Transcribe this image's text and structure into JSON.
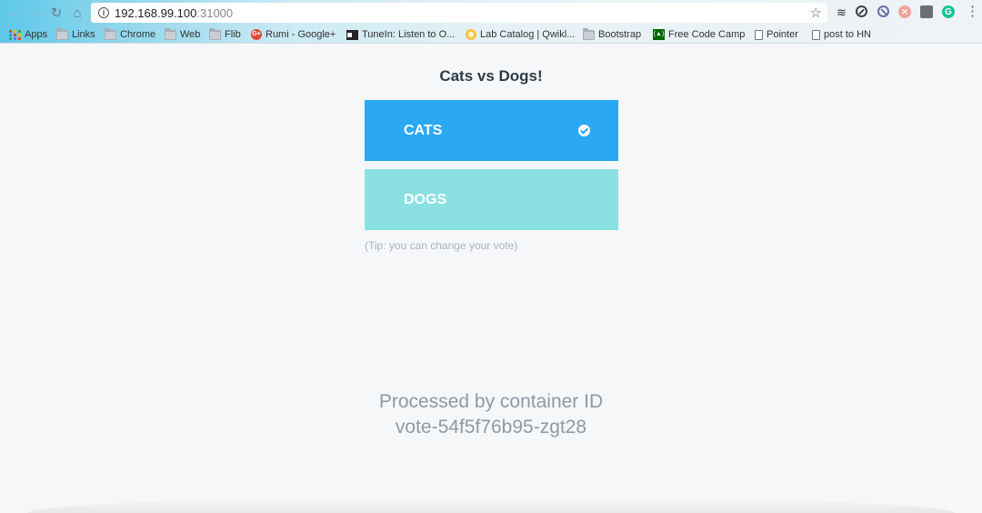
{
  "browser": {
    "url_host": "192.168.99.100",
    "url_port": ":31000",
    "nav": {
      "back_icon": "←",
      "forward_icon": "→",
      "reload_icon": "↻",
      "home_icon": "⌂",
      "star_icon": "☆",
      "menu_icon": "⋮"
    },
    "extensions": [
      {
        "name": "buffer-extension-icon",
        "glyph": "≋"
      },
      {
        "name": "compass-extension-icon",
        "glyph": ""
      },
      {
        "name": "block-extension-icon",
        "glyph": ""
      },
      {
        "name": "red-extension-icon",
        "glyph": "✕"
      },
      {
        "name": "bulb-extension-icon",
        "glyph": "💡"
      },
      {
        "name": "grammarly-extension-icon",
        "glyph": "G"
      }
    ],
    "bookmarks": [
      {
        "label": "Apps",
        "icon": "apps-icon"
      },
      {
        "label": "Links",
        "icon": "folder-icon"
      },
      {
        "label": "Chrome",
        "icon": "folder-icon"
      },
      {
        "label": "Web",
        "icon": "folder-icon"
      },
      {
        "label": "Flib",
        "icon": "folder-icon"
      },
      {
        "label": "Rumi - Google+",
        "icon": "google-plus-icon",
        "glyph": "G+"
      },
      {
        "label": "TuneIn: Listen to O...",
        "icon": "tunein-icon"
      },
      {
        "label": "Lab Catalog | Qwikl...",
        "icon": "qwiklabs-icon"
      },
      {
        "label": "Bootstrap",
        "icon": "folder-icon"
      },
      {
        "label": "Free Code Camp",
        "icon": "freecodecamp-icon",
        "glyph": "(▲)"
      },
      {
        "label": "Pointer",
        "icon": "page-icon"
      },
      {
        "label": "post to HN",
        "icon": "page-icon"
      }
    ]
  },
  "page": {
    "title": "Cats vs Dogs!",
    "options": [
      {
        "label": "CATS",
        "selected": true,
        "color": "#2aa8f3"
      },
      {
        "label": "DOGS",
        "selected": false,
        "color": "#8be1e2"
      }
    ],
    "tip": "(Tip: you can change your vote)",
    "processed_label": "Processed by container ID",
    "container_id": "vote-54f5f76b95-zgt28"
  }
}
